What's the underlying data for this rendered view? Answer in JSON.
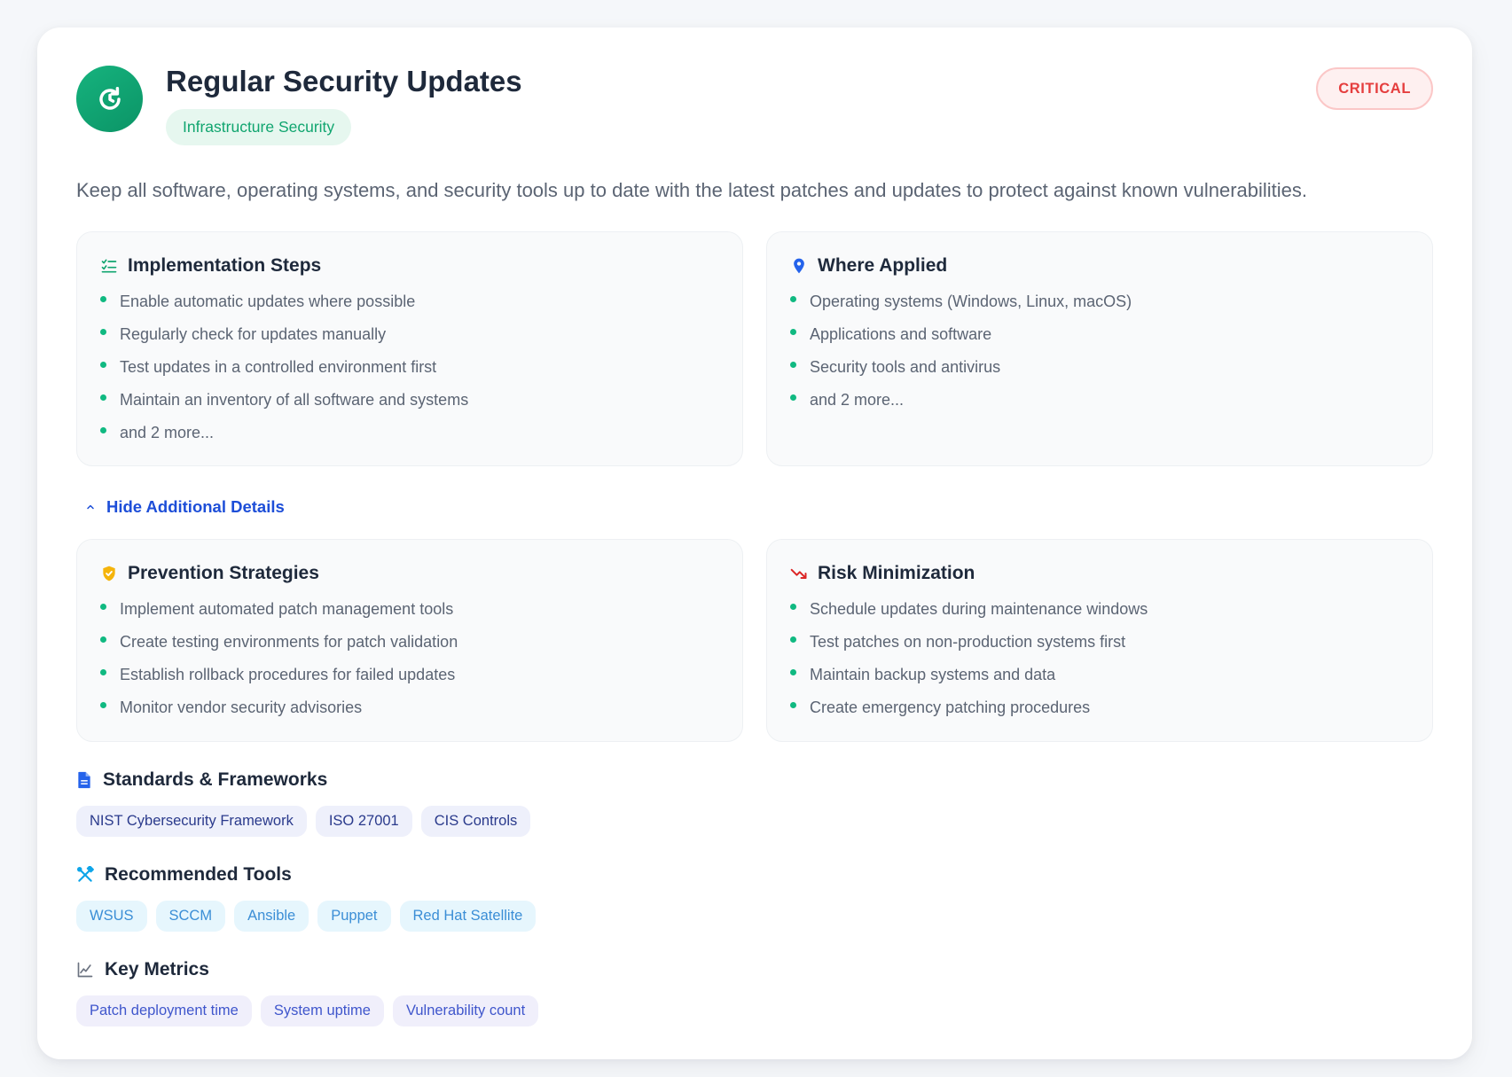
{
  "header": {
    "title": "Regular Security Updates",
    "category": "Infrastructure Security",
    "severity": "CRITICAL",
    "icon": "refresh-icon"
  },
  "description": "Keep all software, operating systems, and security tools up to date with the latest patches and updates to protect against known vulnerabilities.",
  "implementation": {
    "title": "Implementation Steps",
    "items": [
      "Enable automatic updates where possible",
      "Regularly check for updates manually",
      "Test updates in a controlled environment first",
      "Maintain an inventory of all software and systems",
      "and 2 more..."
    ]
  },
  "where_applied": {
    "title": "Where Applied",
    "items": [
      "Operating systems (Windows, Linux, macOS)",
      "Applications and software",
      "Security tools and antivirus",
      "and 2 more..."
    ]
  },
  "toggle": {
    "label": "Hide Additional Details"
  },
  "prevention": {
    "title": "Prevention Strategies",
    "items": [
      "Implement automated patch management tools",
      "Create testing environments for patch validation",
      "Establish rollback procedures for failed updates",
      "Monitor vendor security advisories"
    ]
  },
  "risk": {
    "title": "Risk Minimization",
    "items": [
      "Schedule updates during maintenance windows",
      "Test patches on non-production systems first",
      "Maintain backup systems and data",
      "Create emergency patching procedures"
    ]
  },
  "standards": {
    "title": "Standards & Frameworks",
    "chips": [
      "NIST Cybersecurity Framework",
      "ISO 27001",
      "CIS Controls"
    ]
  },
  "tools": {
    "title": "Recommended Tools",
    "chips": [
      "WSUS",
      "SCCM",
      "Ansible",
      "Puppet",
      "Red Hat Satellite"
    ]
  },
  "metrics": {
    "title": "Key Metrics",
    "chips": [
      "Patch deployment time",
      "System uptime",
      "Vulnerability count"
    ]
  },
  "colors": {
    "accent_green": "#10b981",
    "critical_red": "#e53e3e",
    "link_blue": "#1d4ed8"
  }
}
